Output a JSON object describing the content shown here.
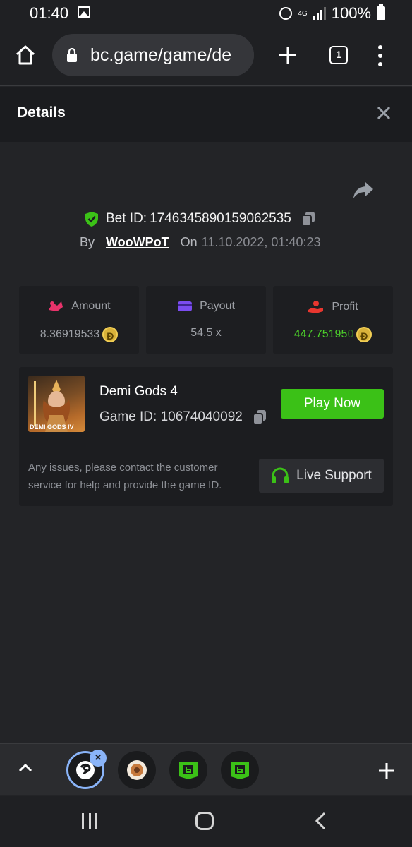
{
  "status_bar": {
    "time": "01:40",
    "network": "4G",
    "battery": "100%"
  },
  "browser": {
    "url": "bc.game/game/de",
    "tab_count": "1"
  },
  "details": {
    "title": "Details"
  },
  "bet": {
    "label": "Bet ID:",
    "id": "1746345890159062535",
    "by_label": "By",
    "username": "WooWPoT",
    "on_label": "On",
    "date": "11.10.2022, 01:40:23"
  },
  "stats": {
    "amount": {
      "label": "Amount",
      "value": "8.36919533",
      "coin": "Ð"
    },
    "payout": {
      "label": "Payout",
      "value": "54.5 x"
    },
    "profit": {
      "label": "Profit",
      "value": "447.75195",
      "value_fade": "0",
      "coin": "Ð"
    }
  },
  "game": {
    "thumb_label": "DEMI GODS IV",
    "name": "Demi Gods 4",
    "id_label": "Game ID:",
    "id": "10674040092",
    "play_label": "Play Now",
    "help_text": "Any issues, please contact the customer service for help and provide the game ID.",
    "support_label": "Live Support"
  },
  "colors": {
    "accent_green": "#3bc117",
    "profit_green": "#4ccf2a",
    "amount_pink": "#e8336b",
    "payout_purple": "#7b4cf0",
    "profit_red": "#e8362f"
  }
}
